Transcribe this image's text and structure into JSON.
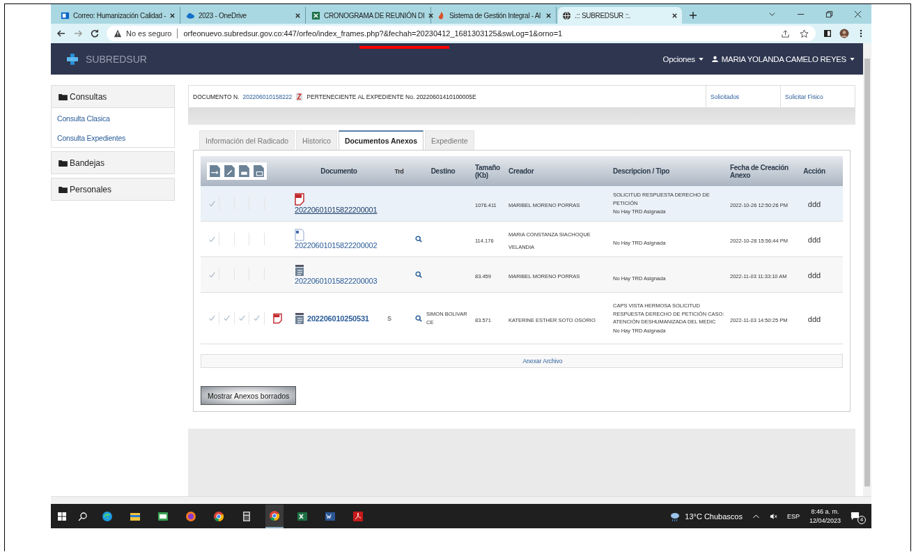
{
  "browser": {
    "tabs": [
      {
        "title": "Correo: Humanización Calidad - ",
        "kind": "mail",
        "selected": false
      },
      {
        "title": "2023 - OneDrive",
        "kind": "cloud",
        "selected": false
      },
      {
        "title": "CRONOGRAMA DE REUNIÓN DI",
        "kind": "sheet",
        "selected": false
      },
      {
        "title": "Sistema de Gestión Integral - Al",
        "kind": "flame",
        "selected": false
      },
      {
        "title": ".:: SUBREDSUR ::.",
        "kind": "globe",
        "selected": true
      }
    ],
    "security": "No es seguro",
    "url": "orfeonuevo.subredsur.gov.co:447/orfeo/index_frames.php?&fechah=20230412_1681303125&swLog=1&orno=1"
  },
  "navbar": {
    "brand": "SUBREDSUR",
    "options": "Opciones",
    "user": "MARIA YOLANDA CAMELO REYES"
  },
  "sidebar": [
    {
      "title": "Consultas",
      "items": [
        "Consulta Clasica",
        "Consulta Expedientes"
      ]
    },
    {
      "title": "Bandejas"
    },
    {
      "title": "Personales"
    }
  ],
  "document_bar": {
    "label": "DOCUMENTO N.",
    "number": "202206010158222",
    "expediente": "PERTENECIENTE AL EXPEDIENTE No. 20220601410100005E",
    "links": [
      "Solicitados",
      "Solicitar Fisico"
    ]
  },
  "tabs": [
    {
      "label": "Información del Radicado",
      "selected": false
    },
    {
      "label": "Historico",
      "selected": false
    },
    {
      "label": "Documentos Anexos",
      "selected": true
    },
    {
      "label": "Expediente",
      "selected": false
    }
  ],
  "table": {
    "columns": [
      "Documento",
      "Trd",
      "Destino",
      "Tamaño (Kb)",
      "Creador",
      "Descripcion / Tipo",
      "Fecha de Creación Anexo",
      "Acción"
    ],
    "rows": [
      {
        "kind": "anexo",
        "selected": true,
        "checks": [
          true,
          false,
          false,
          false
        ],
        "file_icon": {
          "kind": "pdf"
        },
        "number": "20220601015822200001",
        "view": false,
        "size": "1076.411",
        "creador": "MARIBEL MORENO PORRAS",
        "descripcion": "SOLICITUD RESPUESTA DERECHO DE PETICIÓN",
        "trd_note": "No Hay TRD Asignada",
        "fecha": "2022-10-26 12:50:26 PM",
        "accion": "ddd"
      },
      {
        "kind": "anexo",
        "selected": false,
        "checks": [
          true,
          false,
          false,
          false
        ],
        "file_icon": {
          "kind": "word"
        },
        "number": "20220601015822200002",
        "view": true,
        "size": "114.176",
        "creador": "MARIA CONSTANZA SIACHOQUE VELANDIA",
        "trd_note": "No Hay TRD Asignada",
        "fecha": "2022-10-28 15:56:44 PM",
        "accion": "ddd"
      },
      {
        "kind": "anexo",
        "selected": false,
        "checks": [
          true,
          false,
          false,
          false
        ],
        "file_icon": {
          "kind": "scan"
        },
        "number": "20220601015822200003",
        "view": true,
        "size": "83.459",
        "creador": "MARIBEL MORENO PORRAS",
        "trd_note": "No Hay TRD Asignada",
        "fecha": "2022-11-03 11:33:10 AM",
        "accion": "ddd"
      },
      {
        "kind": "radicado",
        "selected": false,
        "checks": [
          true,
          true,
          true,
          true
        ],
        "badge": {
          "kind": "pdf"
        },
        "file_icon": {
          "kind": "scan"
        },
        "number": "202206010250531",
        "trd": "S",
        "view": true,
        "destino": "SIMON BOLIVAR CE",
        "size": "83.571",
        "creador": "KATERINE ESTHER SOTO OSORIO",
        "descripcion": "CAPS VISTA HERMOSA SOLICITUD RESPUESTA DERECHO DE PETICIÓN CASO: ATENCIÓN DESHUMANIZADA DEL MEDIC",
        "trd_note": "No Hay TRD Asignada",
        "fecha": "2022-11-03 14:50:25 PM",
        "accion": "ddd"
      }
    ],
    "footer_link": "Anexar Archivo"
  },
  "deleted_button": "Mostrar Anexos borrados",
  "taskbar": {
    "weather": "13°C  Chubascos",
    "language": "ESP",
    "time": "8:46 a. m.",
    "date": "12/04/2023",
    "notifications": "4"
  }
}
